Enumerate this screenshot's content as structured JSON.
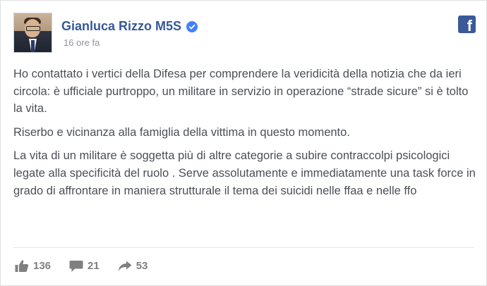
{
  "post": {
    "author": "Gianluca Rizzo M5S",
    "verified_icon": "verified-badge-icon",
    "timestamp": "16 ore fa",
    "paragraphs": [
      "Ho contattato i vertici della Difesa per comprendere la veridicità della notizia che da ieri circola: è ufficiale purtroppo, un militare in servizio in operazione “strade sicure” si è tolto la vita.",
      "Riserbo e vicinanza alla famiglia della vittima in questo momento.",
      "La vita di un militare è soggetta più di altre categorie a subire contraccolpi psicologici legate alla specificità del ruolo . Serve assolutamente e immediatamente una task force in grado di affrontare in maniera strutturale il tema dei suicidi nelle ffaa e nelle ffo"
    ],
    "brand_logo": "f"
  },
  "stats": {
    "likes": "136",
    "comments": "21",
    "shares": "53"
  },
  "colors": {
    "name": "#365899",
    "facebook_blue": "#3b5998",
    "verified_badge": "#4080ff",
    "body_text": "#4b4f56",
    "timestamp": "#90949c"
  }
}
